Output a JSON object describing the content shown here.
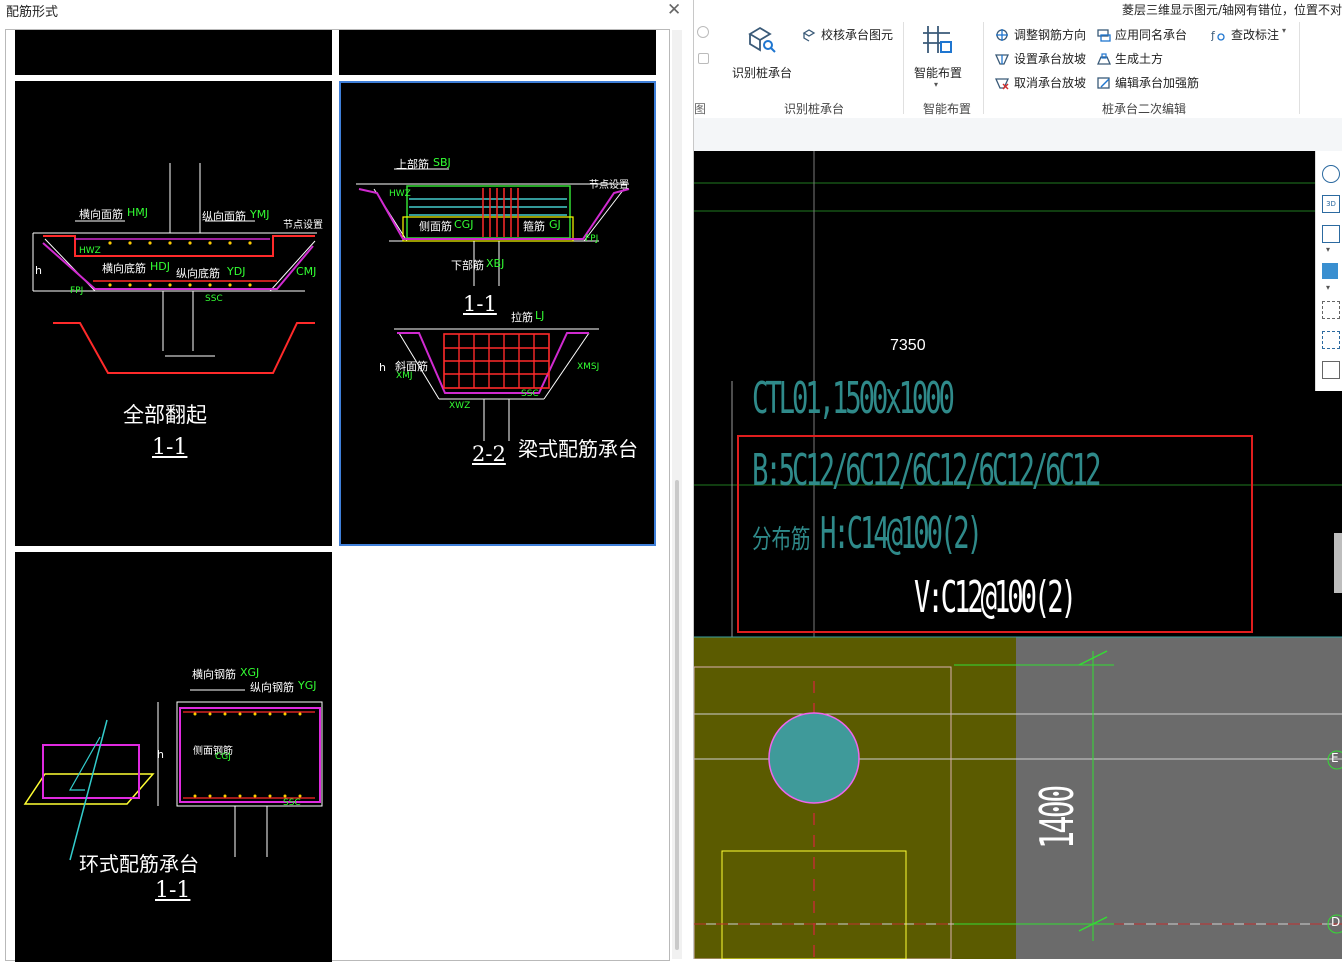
{
  "dialog": {
    "title": "配筋形式",
    "close_glyph": "✕",
    "options": [
      {
        "caption": "全部翻起",
        "section": "1-1",
        "labels": [
          "横向面筋",
          "HMJ",
          "纵向面筋",
          "YMJ",
          "横向底筋",
          "HDJ",
          "纵向底筋",
          "YDJ",
          "CMJ",
          "HWZ",
          "FPJ",
          "SSC",
          "h",
          "节点设置"
        ]
      },
      {
        "caption": "梁式配筋承台",
        "sections": [
          "1-1",
          "2-2"
        ],
        "labels": [
          "上部筋",
          "SBJ",
          "侧面筋",
          "CGJ",
          "箍筋",
          "GJ",
          "下部筋",
          "XBJ",
          "FPJ",
          "拉筋",
          "LJ",
          "斜面筋",
          "XMJ",
          "XMSJ",
          "XWZ",
          "HWZ",
          "SSC",
          "h",
          "节点设置"
        ],
        "selected": true
      },
      {
        "caption": "环式配筋承台",
        "section": "1-1",
        "labels": [
          "横向钢筋",
          "XGJ",
          "纵向钢筋",
          "YGJ",
          "侧面钢筋",
          "CGJ",
          "SSC",
          "h"
        ]
      }
    ]
  },
  "ribbon": {
    "top_notice": "菱层三维显示图元/轴网有错位，位置不对",
    "left_fragment": "图",
    "buttons": {
      "identify_pile_cap": "识别桩承台",
      "check_pile_cap": "校核承台图元",
      "smart_layout": "智能布置",
      "adjust_rebar_dir": "调整钢筋方向",
      "apply_same_name": "应用同名承台",
      "check_mark": "查改标注",
      "set_slope": "设置承台放坡",
      "gen_earthwork": "生成土方",
      "cancel_slope": "取消承台放坡",
      "edit_reinforce": "编辑承台加强筋"
    },
    "groups": {
      "identify": "识别桩承台",
      "smart": "智能布置",
      "secondary_edit": "桩承台二次编辑"
    }
  },
  "cad": {
    "dimension_top": "7350",
    "annotation_name": "CTL01,1500x1000",
    "annotation_b": "B:5C12/6C12/6C12/6C12/6C12",
    "annotation_dist_label": "分布筋",
    "annotation_h": "H:C14@100(2)",
    "annotation_v": "V:C12@100(2)",
    "dimension_side": "1400",
    "axis_labels": [
      "E",
      "D"
    ]
  }
}
